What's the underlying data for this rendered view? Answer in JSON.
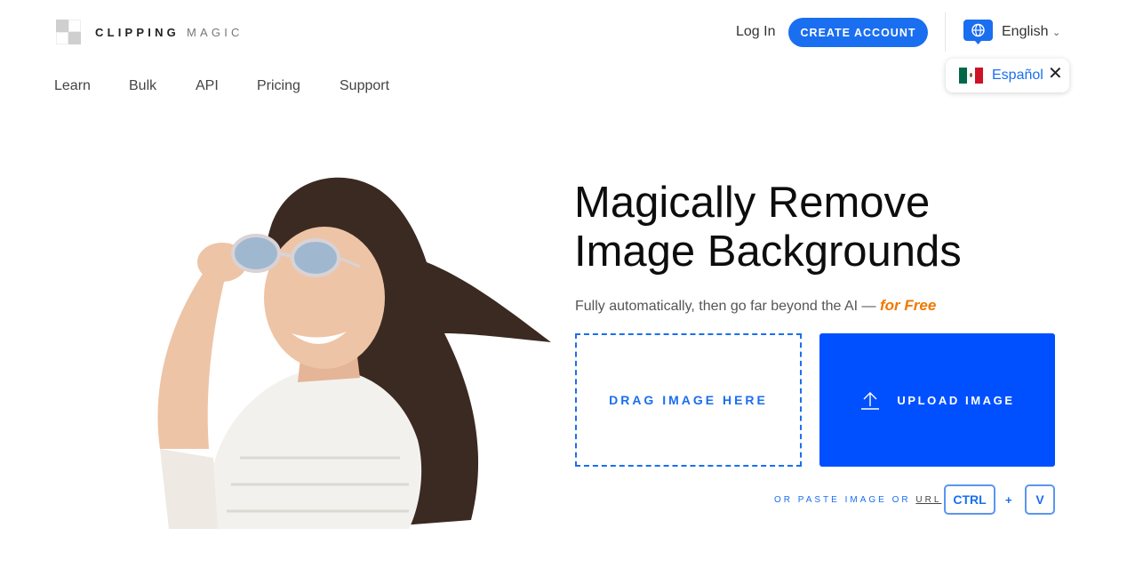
{
  "header": {
    "logo_bold": "CLIPPING",
    "logo_light": "MAGIC",
    "login_label": "Log In",
    "create_account_label": "CREATE ACCOUNT",
    "language_label": "English",
    "language_popup_label": "Español"
  },
  "nav": {
    "items": [
      {
        "label": "Learn"
      },
      {
        "label": "Bulk"
      },
      {
        "label": "API"
      },
      {
        "label": "Pricing"
      },
      {
        "label": "Support"
      }
    ]
  },
  "hero": {
    "headline_line1": "Magically Remove",
    "headline_line2": "Image Backgrounds",
    "subhead": "Fully automatically, then go far beyond the AI — ",
    "subhead_free": "for Free",
    "drag_label": "DRAG IMAGE HERE",
    "upload_label": "UPLOAD IMAGE",
    "paste_prefix": "OR PASTE IMAGE OR ",
    "paste_url": "URL",
    "key_ctrl": "CTRL",
    "key_plus": "+",
    "key_v": "V"
  },
  "colors": {
    "accent": "#1a6ef0",
    "upload_bg": "#0050ff",
    "free_text": "#f07800"
  },
  "icons": {
    "logo": "checker-logo-icon",
    "language": "globe-chat-icon",
    "chevron": "chevron-down-icon",
    "flag": "mexico-flag-icon",
    "close": "close-icon",
    "upload": "upload-arrow-icon"
  }
}
